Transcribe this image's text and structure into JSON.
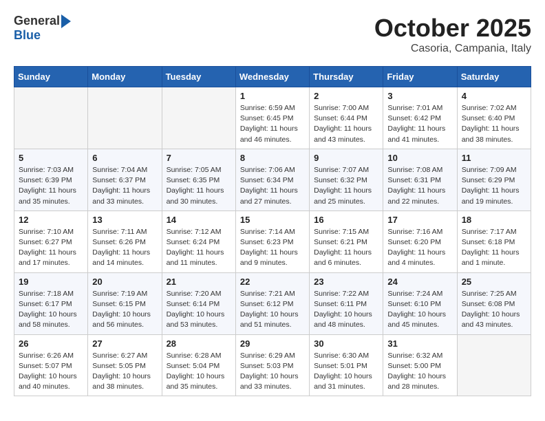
{
  "logo": {
    "general": "General",
    "blue": "Blue"
  },
  "title": "October 2025",
  "location": "Casoria, Campania, Italy",
  "weekdays": [
    "Sunday",
    "Monday",
    "Tuesday",
    "Wednesday",
    "Thursday",
    "Friday",
    "Saturday"
  ],
  "weeks": [
    [
      {
        "day": "",
        "info": ""
      },
      {
        "day": "",
        "info": ""
      },
      {
        "day": "",
        "info": ""
      },
      {
        "day": "1",
        "info": "Sunrise: 6:59 AM\nSunset: 6:45 PM\nDaylight: 11 hours and 46 minutes."
      },
      {
        "day": "2",
        "info": "Sunrise: 7:00 AM\nSunset: 6:44 PM\nDaylight: 11 hours and 43 minutes."
      },
      {
        "day": "3",
        "info": "Sunrise: 7:01 AM\nSunset: 6:42 PM\nDaylight: 11 hours and 41 minutes."
      },
      {
        "day": "4",
        "info": "Sunrise: 7:02 AM\nSunset: 6:40 PM\nDaylight: 11 hours and 38 minutes."
      }
    ],
    [
      {
        "day": "5",
        "info": "Sunrise: 7:03 AM\nSunset: 6:39 PM\nDaylight: 11 hours and 35 minutes."
      },
      {
        "day": "6",
        "info": "Sunrise: 7:04 AM\nSunset: 6:37 PM\nDaylight: 11 hours and 33 minutes."
      },
      {
        "day": "7",
        "info": "Sunrise: 7:05 AM\nSunset: 6:35 PM\nDaylight: 11 hours and 30 minutes."
      },
      {
        "day": "8",
        "info": "Sunrise: 7:06 AM\nSunset: 6:34 PM\nDaylight: 11 hours and 27 minutes."
      },
      {
        "day": "9",
        "info": "Sunrise: 7:07 AM\nSunset: 6:32 PM\nDaylight: 11 hours and 25 minutes."
      },
      {
        "day": "10",
        "info": "Sunrise: 7:08 AM\nSunset: 6:31 PM\nDaylight: 11 hours and 22 minutes."
      },
      {
        "day": "11",
        "info": "Sunrise: 7:09 AM\nSunset: 6:29 PM\nDaylight: 11 hours and 19 minutes."
      }
    ],
    [
      {
        "day": "12",
        "info": "Sunrise: 7:10 AM\nSunset: 6:27 PM\nDaylight: 11 hours and 17 minutes."
      },
      {
        "day": "13",
        "info": "Sunrise: 7:11 AM\nSunset: 6:26 PM\nDaylight: 11 hours and 14 minutes."
      },
      {
        "day": "14",
        "info": "Sunrise: 7:12 AM\nSunset: 6:24 PM\nDaylight: 11 hours and 11 minutes."
      },
      {
        "day": "15",
        "info": "Sunrise: 7:14 AM\nSunset: 6:23 PM\nDaylight: 11 hours and 9 minutes."
      },
      {
        "day": "16",
        "info": "Sunrise: 7:15 AM\nSunset: 6:21 PM\nDaylight: 11 hours and 6 minutes."
      },
      {
        "day": "17",
        "info": "Sunrise: 7:16 AM\nSunset: 6:20 PM\nDaylight: 11 hours and 4 minutes."
      },
      {
        "day": "18",
        "info": "Sunrise: 7:17 AM\nSunset: 6:18 PM\nDaylight: 11 hours and 1 minute."
      }
    ],
    [
      {
        "day": "19",
        "info": "Sunrise: 7:18 AM\nSunset: 6:17 PM\nDaylight: 10 hours and 58 minutes."
      },
      {
        "day": "20",
        "info": "Sunrise: 7:19 AM\nSunset: 6:15 PM\nDaylight: 10 hours and 56 minutes."
      },
      {
        "day": "21",
        "info": "Sunrise: 7:20 AM\nSunset: 6:14 PM\nDaylight: 10 hours and 53 minutes."
      },
      {
        "day": "22",
        "info": "Sunrise: 7:21 AM\nSunset: 6:12 PM\nDaylight: 10 hours and 51 minutes."
      },
      {
        "day": "23",
        "info": "Sunrise: 7:22 AM\nSunset: 6:11 PM\nDaylight: 10 hours and 48 minutes."
      },
      {
        "day": "24",
        "info": "Sunrise: 7:24 AM\nSunset: 6:10 PM\nDaylight: 10 hours and 45 minutes."
      },
      {
        "day": "25",
        "info": "Sunrise: 7:25 AM\nSunset: 6:08 PM\nDaylight: 10 hours and 43 minutes."
      }
    ],
    [
      {
        "day": "26",
        "info": "Sunrise: 6:26 AM\nSunset: 5:07 PM\nDaylight: 10 hours and 40 minutes."
      },
      {
        "day": "27",
        "info": "Sunrise: 6:27 AM\nSunset: 5:05 PM\nDaylight: 10 hours and 38 minutes."
      },
      {
        "day": "28",
        "info": "Sunrise: 6:28 AM\nSunset: 5:04 PM\nDaylight: 10 hours and 35 minutes."
      },
      {
        "day": "29",
        "info": "Sunrise: 6:29 AM\nSunset: 5:03 PM\nDaylight: 10 hours and 33 minutes."
      },
      {
        "day": "30",
        "info": "Sunrise: 6:30 AM\nSunset: 5:01 PM\nDaylight: 10 hours and 31 minutes."
      },
      {
        "day": "31",
        "info": "Sunrise: 6:32 AM\nSunset: 5:00 PM\nDaylight: 10 hours and 28 minutes."
      },
      {
        "day": "",
        "info": ""
      }
    ]
  ]
}
